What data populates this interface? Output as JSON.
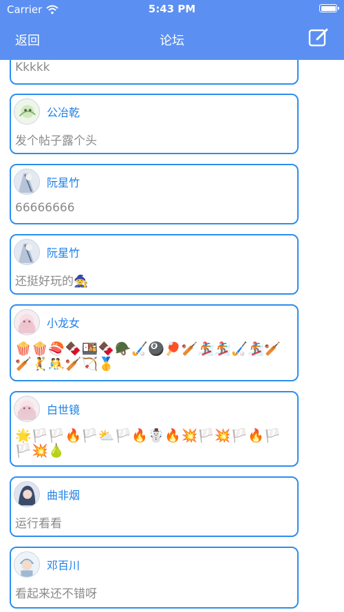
{
  "status_bar": {
    "carrier": "Carrier",
    "time": "5:43 PM"
  },
  "nav": {
    "back_label": "返回",
    "title": "论坛",
    "compose_icon": "compose-icon"
  },
  "colors": {
    "nav_background": "#5b8ff2",
    "card_border": "#2a8dee",
    "author_name": "#1b7fe6",
    "post_text": "#8a8a8a"
  },
  "posts": [
    {
      "author": "",
      "content": "Kkkkk"
    },
    {
      "author": "公冶乾",
      "content": "发个帖子露个头",
      "avatar_icon": "avatar-icon"
    },
    {
      "author": "阮星竹",
      "content": "66666666",
      "avatar_icon": "avatar-icon"
    },
    {
      "author": "阮星竹",
      "content": "还挺好玩的🧙",
      "avatar_icon": "avatar-icon"
    },
    {
      "author": "小龙女",
      "content": "🍿🍿🍣🍫🍱🍫🪖🏑🎱🏓🏏🏂🏂🏑🏂🏏🏏🤾🤼🏏🏹🥇",
      "avatar_icon": "avatar-icon"
    },
    {
      "author": "白世镜",
      "content": "🌟🏳️🏳️🔥🏳️⛅🏳️🔥☃️🔥💥🏳️💥🏳️🔥🏳️🏳️💥🍐",
      "avatar_icon": "avatar-icon"
    },
    {
      "author": "曲非烟",
      "content": "运行看看",
      "avatar_icon": "avatar-icon"
    },
    {
      "author": "邓百川",
      "content": "看起来还不错呀",
      "avatar_icon": "avatar-icon"
    }
  ]
}
